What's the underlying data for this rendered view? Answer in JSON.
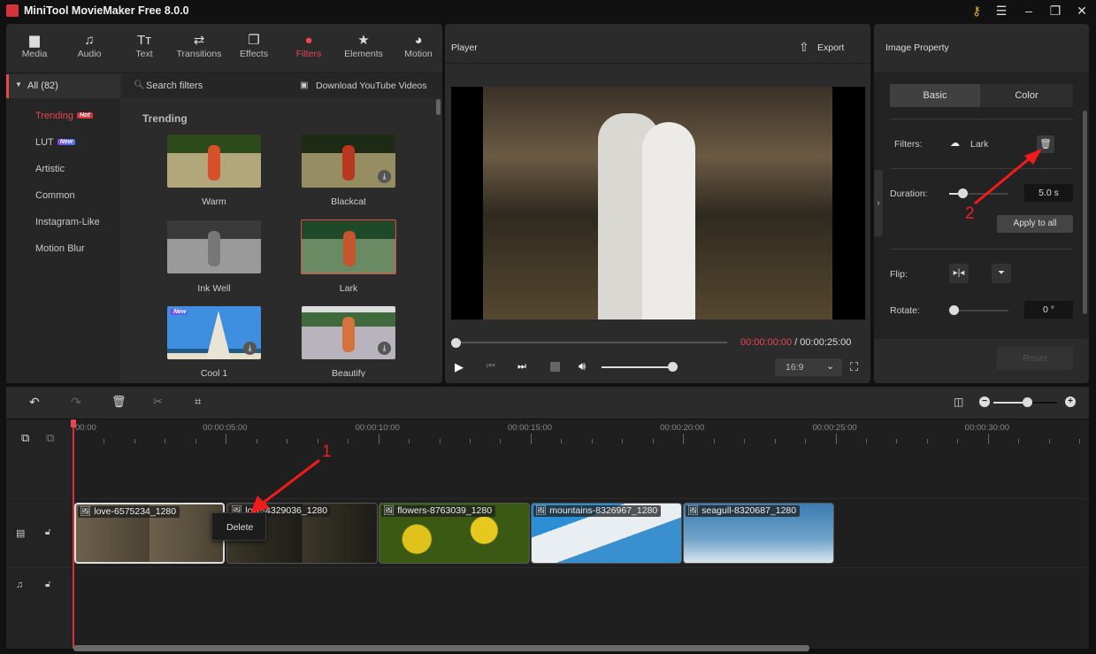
{
  "app": {
    "title": "MiniTool MovieMaker Free 8.0.0"
  },
  "window_controls": {
    "key_icon": "key-icon",
    "menu_icon": "menu-icon",
    "minimize_icon": "minimize-icon",
    "maximize_icon": "maximize-icon",
    "close_icon": "close-icon"
  },
  "toolbar": {
    "tabs": [
      {
        "label": "Media",
        "icon": "folder-icon"
      },
      {
        "label": "Audio",
        "icon": "music-icon"
      },
      {
        "label": "Text",
        "icon": "text-icon"
      },
      {
        "label": "Transitions",
        "icon": "transitions-icon"
      },
      {
        "label": "Effects",
        "icon": "effects-icon"
      },
      {
        "label": "Filters",
        "icon": "filters-icon",
        "active": true
      },
      {
        "label": "Elements",
        "icon": "elements-icon"
      },
      {
        "label": "Motion",
        "icon": "motion-icon"
      }
    ]
  },
  "filters_sidebar": {
    "all_label": "All (82)",
    "categories": [
      {
        "label": "Trending",
        "badge": "Hot",
        "active": true
      },
      {
        "label": "LUT",
        "badge": "New"
      },
      {
        "label": "Artistic"
      },
      {
        "label": "Common"
      },
      {
        "label": "Instagram-Like"
      },
      {
        "label": "Motion Blur"
      }
    ]
  },
  "filters_panel": {
    "search_placeholder": "Search filters",
    "download_link": "Download YouTube Videos",
    "section_title": "Trending",
    "items": [
      {
        "label": "Warm"
      },
      {
        "label": "Blackcat",
        "download": true
      },
      {
        "label": "Ink Well"
      },
      {
        "label": "Lark",
        "selected": true
      },
      {
        "label": "Cool 1",
        "badge": "New",
        "download": true
      },
      {
        "label": "Beautify",
        "download": true
      }
    ]
  },
  "player": {
    "title": "Player",
    "export_label": "Export",
    "current_time": "00:00:00:00",
    "separator": " / ",
    "total_time": "00:00:25:00",
    "progress_percent": 0,
    "volume_percent": 100,
    "aspect_ratio": "16:9"
  },
  "property": {
    "title": "Image Property",
    "tabs": [
      "Basic",
      "Color"
    ],
    "active_tab": "Basic",
    "filters_label": "Filters:",
    "filter_value": "Lark",
    "duration_label": "Duration:",
    "duration_value": "5.0 s",
    "duration_slider_percent": 25,
    "apply_all_label": "Apply to all",
    "flip_label": "Flip:",
    "rotate_label": "Rotate:",
    "rotate_value": "0 °",
    "rotate_slider_percent": 0,
    "reset_label": "Reset"
  },
  "annotations": {
    "arrow1": "1",
    "arrow2": "2"
  },
  "timeline": {
    "zoom_percent": 65,
    "ticks": [
      "00:00",
      "00:00:05:00",
      "00:00:10:00",
      "00:00:15:00",
      "00:00:20:00",
      "00:00:25:00",
      "00:00:30:00"
    ],
    "clips": [
      {
        "name": "love-6575234_1280",
        "selected": true
      },
      {
        "name": "love-4329036_1280"
      },
      {
        "name": "flowers-8763039_1280"
      },
      {
        "name": "mountains-8326967_1280"
      },
      {
        "name": "seagull-8320687_1280"
      }
    ],
    "context_menu": {
      "delete_label": "Delete"
    }
  },
  "colors": {
    "accent": "#e8474f",
    "panel": "#2b2b2b",
    "background": "#111111"
  }
}
